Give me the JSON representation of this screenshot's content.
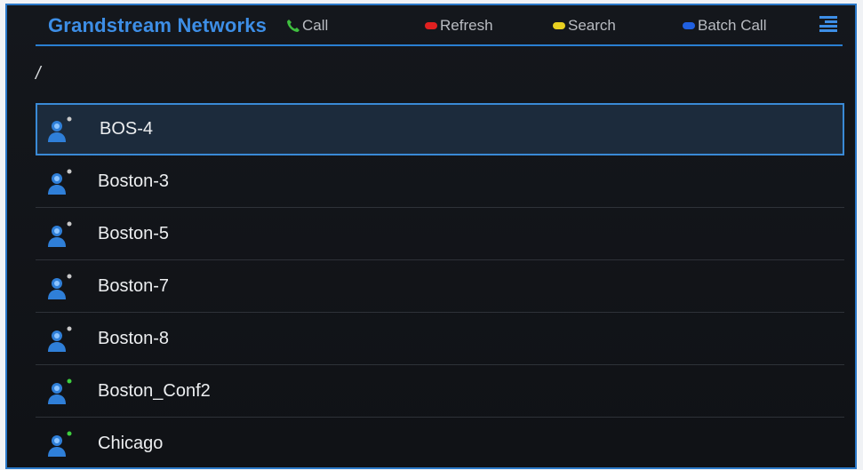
{
  "header": {
    "title": "Grandstream Networks",
    "softkeys": [
      {
        "label": "Call",
        "color": "#3fbf3f",
        "icon": "phone-icon"
      },
      {
        "label": "Refresh",
        "color": "#e02020"
      },
      {
        "label": "Search",
        "color": "#e8d020"
      },
      {
        "label": "Batch Call",
        "color": "#2060e0"
      }
    ],
    "menu_icon": "menu-lines-icon"
  },
  "path": "/",
  "contacts": [
    {
      "name": "BOS-4",
      "status": "offline",
      "selected": true
    },
    {
      "name": "Boston-3",
      "status": "offline"
    },
    {
      "name": "Boston-5",
      "status": "offline"
    },
    {
      "name": "Boston-7",
      "status": "offline"
    },
    {
      "name": "Boston-8",
      "status": "offline"
    },
    {
      "name": "Boston_Conf2",
      "status": "online"
    },
    {
      "name": "Chicago",
      "status": "online"
    }
  ],
  "status_colors": {
    "online": "#3fcf3f",
    "offline": "#c8c8c8"
  },
  "accent": "#2a7fd2"
}
